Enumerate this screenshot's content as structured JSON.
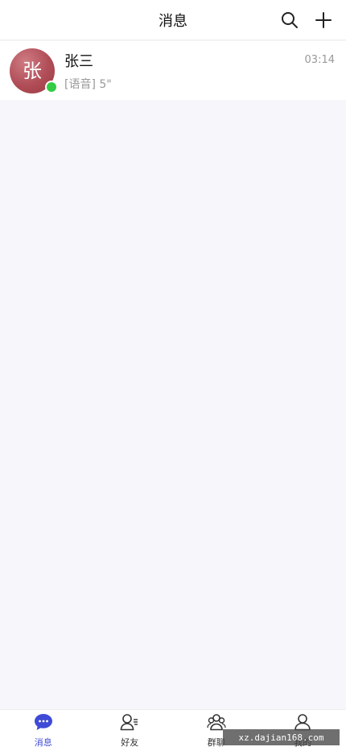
{
  "header": {
    "title": "消息",
    "actions": [
      {
        "icon": "search-icon"
      },
      {
        "icon": "plus-icon"
      }
    ]
  },
  "conversations": [
    {
      "avatar_letter": "张",
      "avatar_color": "#b04d57",
      "online": true,
      "presence_color": "#33cc44",
      "name": "张三",
      "preview": "[语音] 5\"",
      "time": "03:14"
    }
  ],
  "tabbar": {
    "active_color": "#3f4bd6",
    "tabs": [
      {
        "label": "消息",
        "icon": "chat-bubble-icon",
        "active": true
      },
      {
        "label": "好友",
        "icon": "friends-icon",
        "active": false
      },
      {
        "label": "群聊",
        "icon": "group-icon",
        "active": false
      },
      {
        "label": "我的",
        "icon": "user-icon",
        "active": false
      }
    ]
  },
  "watermark": "xz.dajian168.com"
}
